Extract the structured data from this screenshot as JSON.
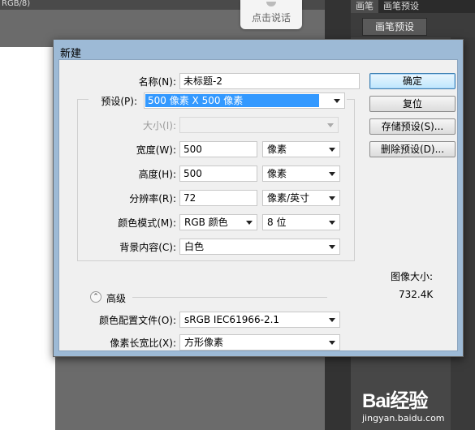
{
  "background": {
    "doc_title": "RGB/8)",
    "speak_button": "点击说话",
    "panel_tabs": [
      "画笔",
      "画笔预设"
    ],
    "brush_preset_button": "画笔预设",
    "watermark_logo": "Bai经验",
    "watermark_site": "jingyan.baidu.com"
  },
  "dialog": {
    "title": "新建",
    "name_label": "名称(N):",
    "name_value": "未标题-2",
    "preset_label": "预设(P):",
    "preset_value": "500 像素 X 500 像素",
    "size_label": "大小(I):",
    "size_value": "",
    "width_label": "宽度(W):",
    "width_value": "500",
    "width_unit": "像素",
    "height_label": "高度(H):",
    "height_value": "500",
    "height_unit": "像素",
    "resolution_label": "分辨率(R):",
    "resolution_value": "72",
    "resolution_unit": "像素/英寸",
    "color_mode_label": "颜色模式(M):",
    "color_mode_value": "RGB 颜色",
    "bit_depth_value": "8 位",
    "background_label": "背景内容(C):",
    "background_value": "白色",
    "advanced_label": "高级",
    "color_profile_label": "颜色配置文件(O):",
    "color_profile_value": "sRGB IEC61966-2.1",
    "pixel_aspect_label": "像素长宽比(X):",
    "pixel_aspect_value": "方形像素",
    "buttons": {
      "ok": "确定",
      "reset": "复位",
      "save_preset": "存储预设(S)...",
      "delete_preset": "删除预设(D)..."
    },
    "image_size_label": "图像大小:",
    "image_size_value": "732.4K"
  }
}
